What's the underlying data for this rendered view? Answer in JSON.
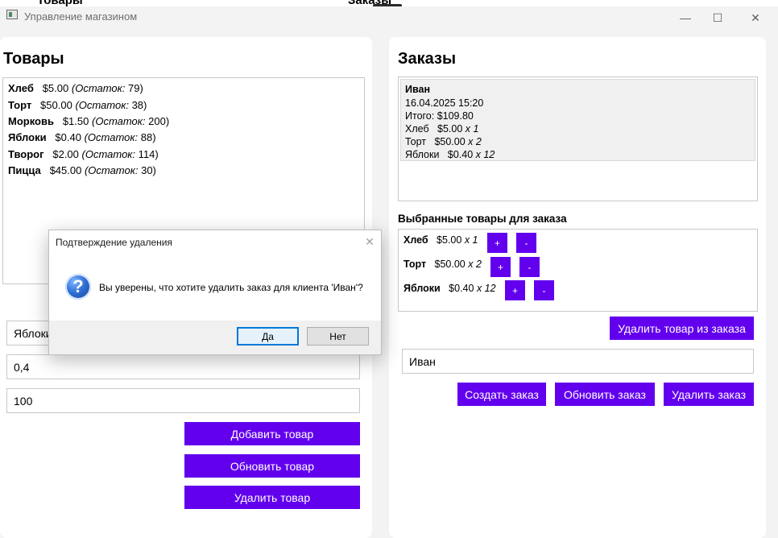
{
  "background": {
    "tab_left": "Товары",
    "tab_right": "Заказы"
  },
  "window": {
    "title": "Управление магазином",
    "minimize": "—",
    "maximize": "☐",
    "close": "✕"
  },
  "products": {
    "heading": "Товары",
    "list": [
      {
        "name": "Хлеб",
        "price": "$5.00",
        "stock_label": "(Остаток:",
        "stock": " 79)"
      },
      {
        "name": "Торт",
        "price": "$50.00",
        "stock_label": "(Остаток:",
        "stock": " 38)"
      },
      {
        "name": "Морковь",
        "price": "$1.50",
        "stock_label": "(Остаток:",
        "stock": " 200)"
      },
      {
        "name": "Яблоки",
        "price": "$0.40",
        "stock_label": "(Остаток:",
        "stock": " 88)"
      },
      {
        "name": "Творог",
        "price": "$2.00",
        "stock_label": "(Остаток:",
        "stock": " 114)"
      },
      {
        "name": "Пицца",
        "price": "$45.00",
        "stock_label": "(Остаток:",
        "stock": " 30)"
      }
    ],
    "name_value": "Яблоки",
    "price_value": "0,4",
    "stock_value": "100",
    "add_button": "Добавить товар",
    "update_button": "Обновить товар",
    "delete_button": "Удалить товар"
  },
  "orders": {
    "heading": "Заказы",
    "order": {
      "customer": "Иван",
      "date": "16.04.2025 15:20",
      "total": "Итого: $109.80",
      "items": [
        {
          "name": "Хлеб",
          "price": "$5.00",
          "qty": "x 1"
        },
        {
          "name": "Торт",
          "price": "$50.00",
          "qty": "x 2"
        },
        {
          "name": "Яблоки",
          "price": "$0.40",
          "qty": "x 12"
        }
      ]
    },
    "selected_heading": "Выбранные товары для заказа",
    "selected": [
      {
        "name": "Хлеб",
        "price": "$5.00",
        "qty": "x 1"
      },
      {
        "name": "Торт",
        "price": "$50.00",
        "qty": "x 2"
      },
      {
        "name": "Яблоки",
        "price": "$0.40",
        "qty": "x 12"
      }
    ],
    "plus": "+",
    "minus": "-",
    "remove_item_button": "Удалить товар из заказа",
    "customer_value": "Иван",
    "create_button": "Создать заказ",
    "update_button": "Обновить заказ",
    "delete_button": "Удалить заказ"
  },
  "dialog": {
    "title": "Подтверждение удаления",
    "close": "✕",
    "icon": "?",
    "message": "Вы уверены, что хотите удалить заказ для клиента 'Иван'?",
    "yes": "Да",
    "no": "Нет"
  },
  "colors": {
    "accent": "#6200ee",
    "dialog_default_border": "#0078d7"
  }
}
